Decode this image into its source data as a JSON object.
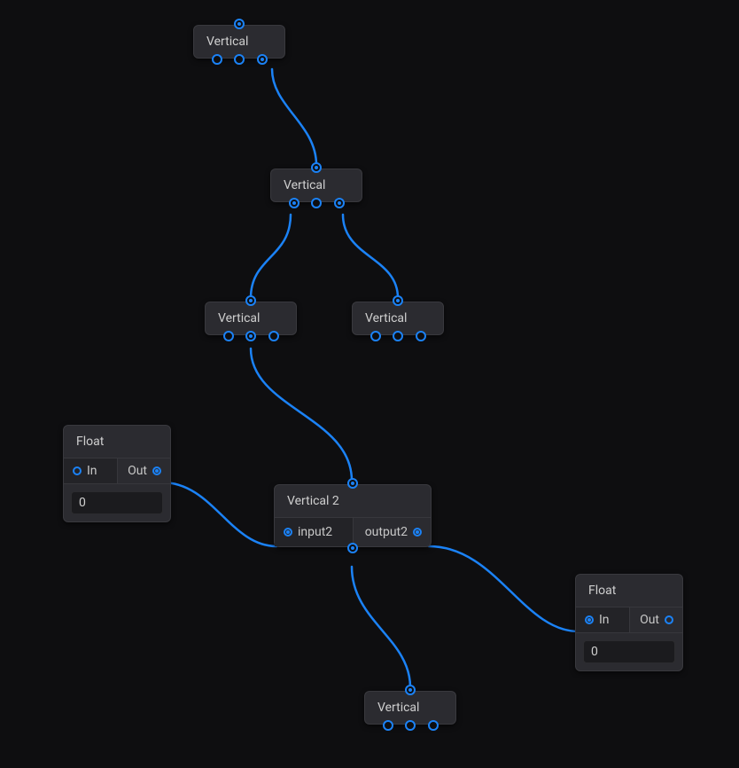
{
  "nodes": {
    "vertical_a": {
      "title": "Vertical"
    },
    "vertical_b": {
      "title": "Vertical"
    },
    "vertical_c": {
      "title": "Vertical"
    },
    "vertical_d": {
      "title": "Vertical"
    },
    "vertical_e": {
      "title": "Vertical"
    },
    "vertical2": {
      "title": "Vertical 2",
      "input_label": "input2",
      "output_label": "output2"
    },
    "float_left": {
      "title": "Float",
      "in_label": "In",
      "out_label": "Out",
      "value": "0"
    },
    "float_right": {
      "title": "Float",
      "in_label": "In",
      "out_label": "Out",
      "value": "0"
    }
  },
  "edges": [
    {
      "from": "vertical_a.bottom3",
      "to": "vertical_b.top"
    },
    {
      "from": "vertical_b.bottom1",
      "to": "vertical_c.top"
    },
    {
      "from": "vertical_b.bottom3",
      "to": "vertical_d.top"
    },
    {
      "from": "vertical_c.bottom2",
      "to": "vertical2.top"
    },
    {
      "from": "float_left.out",
      "to": "vertical2.input2"
    },
    {
      "from": "vertical2.output2",
      "to": "float_right.in"
    },
    {
      "from": "vertical2.bottom",
      "to": "vertical_e.top"
    }
  ],
  "colors": {
    "accent": "#1b82f6",
    "bg": "#0e0e10",
    "node_bg": "#2b2b30"
  }
}
